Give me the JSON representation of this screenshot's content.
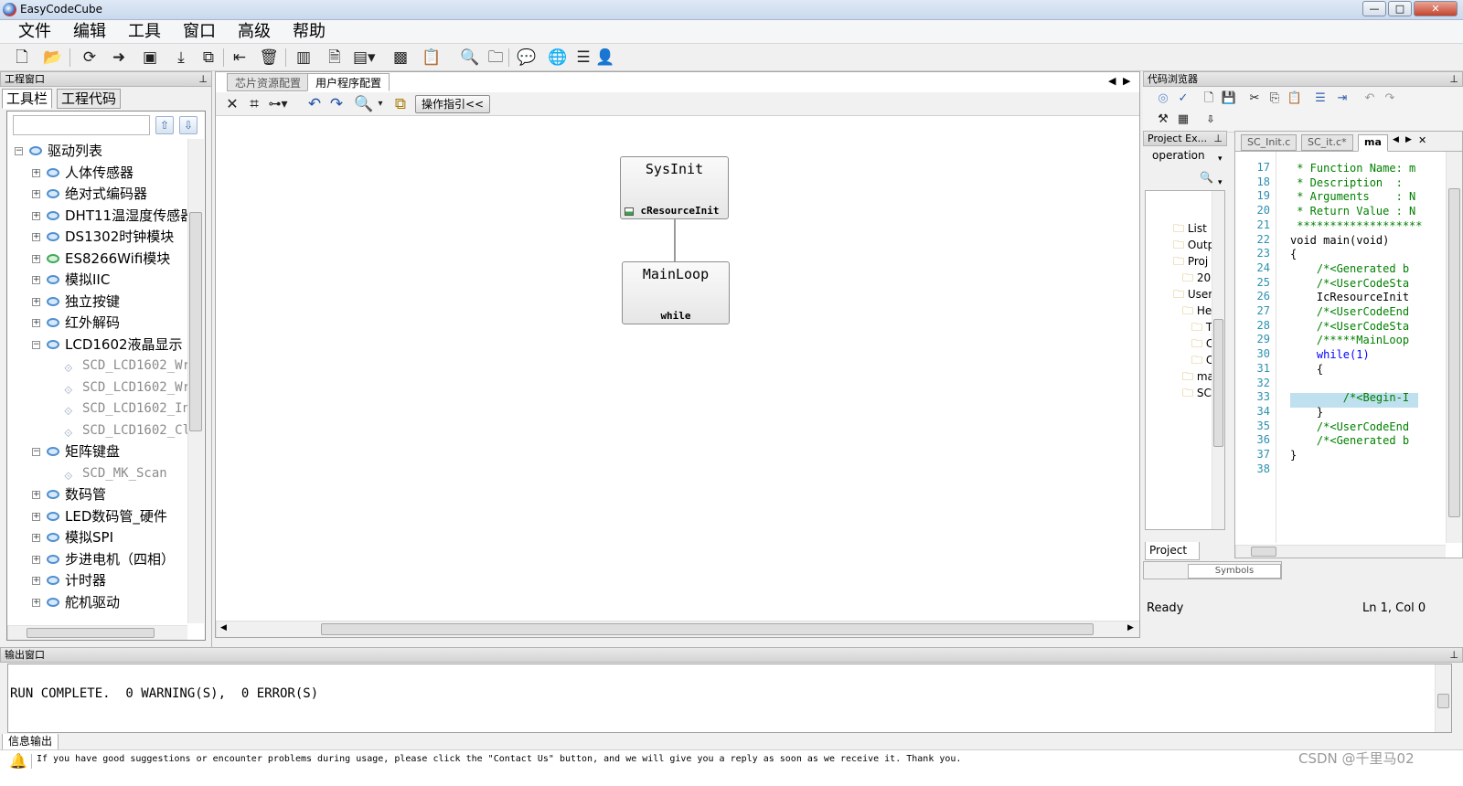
{
  "app": {
    "title": "EasyCodeCube"
  },
  "menu": [
    "文件",
    "编辑",
    "工具",
    "窗口",
    "高级",
    "帮助"
  ],
  "left_panel": {
    "header": "工程窗口",
    "tabs": [
      "工具栏",
      "工程代码"
    ],
    "tree": [
      {
        "label": "驱动列表",
        "level": 0,
        "expander": "−"
      },
      {
        "label": "人体传感器",
        "level": 1,
        "expander": "+"
      },
      {
        "label": "绝对式编码器",
        "level": 1,
        "expander": "+"
      },
      {
        "label": "DHT11温湿度传感器",
        "level": 1,
        "expander": "+"
      },
      {
        "label": "DS1302时钟模块",
        "level": 1,
        "expander": "+"
      },
      {
        "label": "ES8266Wifi模块",
        "level": 1,
        "expander": "+",
        "green": true
      },
      {
        "label": "模拟IIC",
        "level": 1,
        "expander": "+"
      },
      {
        "label": "独立按键",
        "level": 1,
        "expander": "+"
      },
      {
        "label": "红外解码",
        "level": 1,
        "expander": "+"
      },
      {
        "label": "LCD1602液晶显示",
        "level": 1,
        "expander": "−"
      },
      {
        "label": "SCD_LCD1602_Wr",
        "level": 2,
        "grey": true
      },
      {
        "label": "SCD_LCD1602_Wr",
        "level": 2,
        "grey": true
      },
      {
        "label": "SCD_LCD1602_In",
        "level": 2,
        "grey": true
      },
      {
        "label": "SCD_LCD1602_Cl",
        "level": 2,
        "grey": true
      },
      {
        "label": "矩阵键盘",
        "level": 1,
        "expander": "−"
      },
      {
        "label": "SCD_MK_Scan",
        "level": 2,
        "grey": true
      },
      {
        "label": "数码管",
        "level": 1,
        "expander": "+"
      },
      {
        "label": "LED数码管_硬件",
        "level": 1,
        "expander": "+"
      },
      {
        "label": "模拟SPI",
        "level": 1,
        "expander": "+"
      },
      {
        "label": "步进电机（四相）",
        "level": 1,
        "expander": "+"
      },
      {
        "label": "计时器",
        "level": 1,
        "expander": "+"
      },
      {
        "label": "舵机驱动",
        "level": 1,
        "expander": "+"
      }
    ]
  },
  "center": {
    "tabs": [
      "芯片资源配置",
      "用户程序配置"
    ],
    "active_tab": 1,
    "guide_button": "操作指引<<",
    "nodes": [
      {
        "title": "SysInit",
        "sub": "cResourceInit"
      },
      {
        "title": "MainLoop",
        "sub": "while"
      }
    ]
  },
  "right_panel": {
    "header": "代码浏览器",
    "project_explorer": {
      "title": "Project Ex...",
      "dropdown": "operation",
      "items": [
        "List",
        "Outp",
        "Proj",
        "20",
        "User",
        "He",
        "Tm",
        "Ca",
        "Cc",
        "ma",
        "SC"
      ],
      "bottom_tab": "Project",
      "symbols_tab": "Symbols"
    },
    "editor_tabs": [
      "SC_Init.c",
      "SC_it.c*",
      "ma"
    ],
    "code": [
      {
        "n": "17",
        "text": " * Function Name: m",
        "cls": "cmt"
      },
      {
        "n": "18",
        "text": " * Description  : ",
        "cls": "cmt"
      },
      {
        "n": "19",
        "text": " * Arguments    : N",
        "cls": "cmt"
      },
      {
        "n": "20",
        "text": " * Return Value : N",
        "cls": "cmt"
      },
      {
        "n": "21",
        "text": " *******************",
        "cls": "cmt"
      },
      {
        "n": "22",
        "text": "void main(void)",
        "cls": ""
      },
      {
        "n": "23",
        "text": "{",
        "cls": ""
      },
      {
        "n": "24",
        "text": "    /*<Generated b",
        "cls": "cmt"
      },
      {
        "n": "25",
        "text": "    /*<UserCodeSta",
        "cls": "cmt"
      },
      {
        "n": "26",
        "text": "    IcResourceInit",
        "cls": ""
      },
      {
        "n": "27",
        "text": "    /*<UserCodeEnd",
        "cls": "cmt"
      },
      {
        "n": "28",
        "text": "    /*<UserCodeSta",
        "cls": "cmt"
      },
      {
        "n": "29",
        "text": "    /*****MainLoop",
        "cls": "cmt"
      },
      {
        "n": "30",
        "text": "    while(1)",
        "cls": "kw"
      },
      {
        "n": "31",
        "text": "    {",
        "cls": ""
      },
      {
        "n": "32",
        "text": "",
        "cls": ""
      },
      {
        "n": "33",
        "text": "        /*<Begin-I",
        "cls": "cmt"
      },
      {
        "n": "34",
        "text": "    }",
        "cls": ""
      },
      {
        "n": "35",
        "text": "    /*<UserCodeEnd",
        "cls": "cmt"
      },
      {
        "n": "36",
        "text": "    /*<Generated b",
        "cls": "cmt"
      },
      {
        "n": "37",
        "text": "}",
        "cls": ""
      },
      {
        "n": "38",
        "text": "",
        "cls": ""
      }
    ],
    "status_left": "Ready",
    "status_right": "Ln 1, Col 0"
  },
  "output": {
    "header": "输出窗口",
    "line1": "RUN COMPLETE.  0 WARNING(S),  0 ERROR(S)",
    "tab": "信息输出"
  },
  "status_bar": {
    "message": "If you have good suggestions or encounter problems during usage, please click the \"Contact Us\" button, and we will give you a reply as soon as we receive it. Thank you.",
    "watermark": "CSDN @千里马02"
  }
}
